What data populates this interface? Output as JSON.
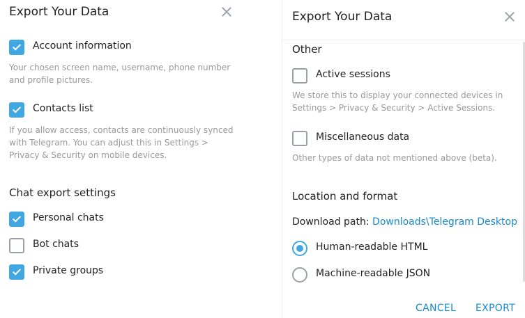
{
  "left": {
    "title": "Export Your Data",
    "account": {
      "label": "Account information",
      "checked": true,
      "desc": "Your chosen screen name, username, phone number and profile pictures."
    },
    "contacts": {
      "label": "Contacts list",
      "checked": true,
      "desc": "If you allow access, contacts are continuously synced with Telegram. You can adjust this in Settings > Privacy & Security on mobile devices."
    },
    "chat_section": "Chat export settings",
    "personal": {
      "label": "Personal chats",
      "checked": true
    },
    "bot": {
      "label": "Bot chats",
      "checked": false
    },
    "private_groups": {
      "label": "Private groups",
      "checked": true
    }
  },
  "right": {
    "title": "Export Your Data",
    "other_section": "Other",
    "sessions": {
      "label": "Active sessions",
      "checked": false,
      "desc": "We store this to display your connected devices in Settings > Privacy & Security > Active Sessions."
    },
    "misc": {
      "label": "Miscellaneous data",
      "checked": false,
      "desc": "Other types of data not mentioned above (beta)."
    },
    "location_section": "Location and format",
    "download_label": "Download path:",
    "download_path": "Downloads\\Telegram Desktop",
    "format_html": {
      "label": "Human-readable HTML",
      "selected": true
    },
    "format_json": {
      "label": "Machine-readable JSON",
      "selected": false
    },
    "cancel": "CANCEL",
    "export": "EXPORT"
  },
  "colors": {
    "accent": "#40a7e3",
    "link": "#168acd",
    "secondary_text": "#999999"
  }
}
